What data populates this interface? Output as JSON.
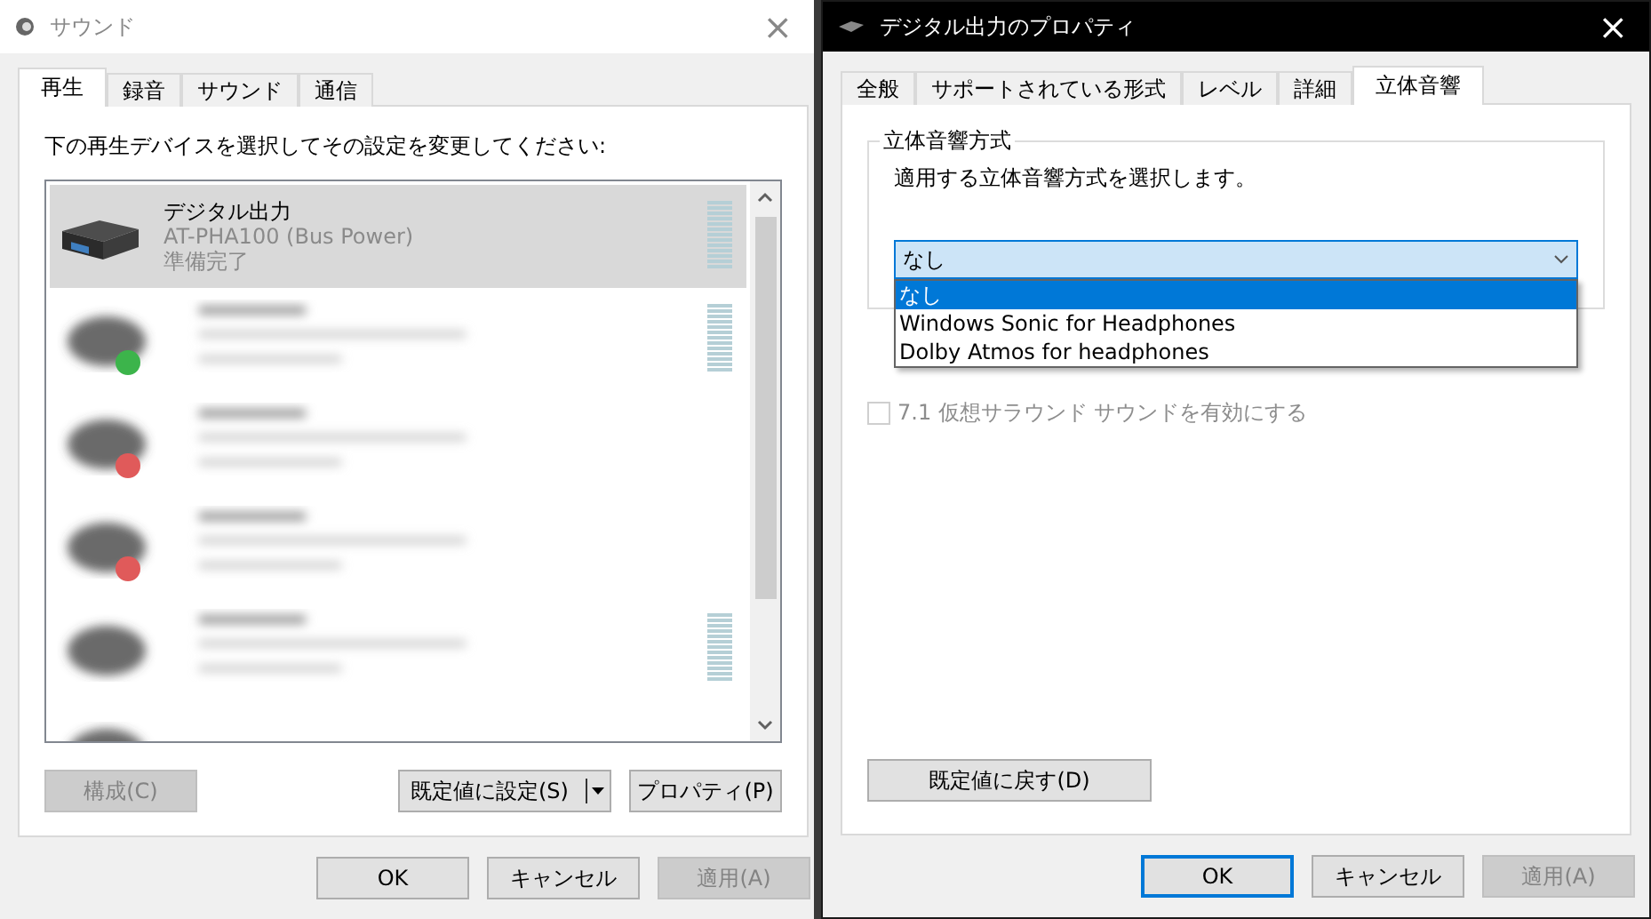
{
  "sound_window": {
    "title": "サウンド",
    "close": "×",
    "tabs": [
      {
        "label": "再生",
        "selected": true
      },
      {
        "label": "録音",
        "selected": false
      },
      {
        "label": "サウンド",
        "selected": false
      },
      {
        "label": "通信",
        "selected": false
      }
    ],
    "instruction": "下の再生デバイスを選択してその設定を変更してください:",
    "devices": [
      {
        "kind": "device",
        "name": "デジタル出力",
        "model": "AT-PHA100 (Bus Power)",
        "status": "準備完了",
        "selected": true,
        "meter": true
      },
      {
        "kind": "blurred",
        "color": "#3cb44b",
        "meter": true,
        "selected": false
      },
      {
        "kind": "blurred",
        "color": "#e05a5a",
        "meter": false,
        "selected": false
      },
      {
        "kind": "blurred",
        "color": "#e05a5a",
        "meter": false,
        "selected": false
      },
      {
        "kind": "blurred",
        "meter": true,
        "selected": false
      },
      {
        "kind": "blurred_partial",
        "meter": false,
        "selected": false
      }
    ],
    "configure_button": {
      "label": "構成(C)",
      "disabled": true
    },
    "set_default_button": {
      "label": "既定値に設定(S)",
      "disabled": false
    },
    "properties_button": {
      "label": "プロパティ(P)",
      "disabled": false
    },
    "buttons": [
      {
        "label": "OK",
        "disabled": false,
        "focused": false
      },
      {
        "label": "キャンセル",
        "disabled": false,
        "focused": false
      },
      {
        "label": "適用(A)",
        "disabled": true,
        "focused": false
      }
    ]
  },
  "properties_window": {
    "title": "デジタル出力のプロパティ",
    "close": "×",
    "tabs": [
      {
        "label": "全般",
        "selected": false
      },
      {
        "label": "サポートされている形式",
        "selected": false
      },
      {
        "label": "レベル",
        "selected": false
      },
      {
        "label": "詳細",
        "selected": false
      },
      {
        "label": "立体音響",
        "selected": true
      }
    ],
    "group_title": "立体音響方式",
    "description": "適用する立体音響方式を選択します。",
    "format_select": {
      "value": "なし",
      "expanded": true,
      "options": [
        {
          "label": "なし",
          "selected": true
        },
        {
          "label": "Windows Sonic for Headphones",
          "selected": false
        },
        {
          "label": "Dolby Atmos for headphones",
          "selected": false
        }
      ]
    },
    "virtual_surround": {
      "label": "7.1 仮想サラウンド サウンドを有効にする",
      "checked": false,
      "disabled": true
    },
    "restore_button": {
      "label": "既定値に戻す(D)",
      "disabled": false
    },
    "buttons": [
      {
        "label": "OK",
        "disabled": false,
        "focused": true
      },
      {
        "label": "キャンセル",
        "disabled": false,
        "focused": false
      },
      {
        "label": "適用(A)",
        "disabled": true,
        "focused": false
      }
    ]
  }
}
